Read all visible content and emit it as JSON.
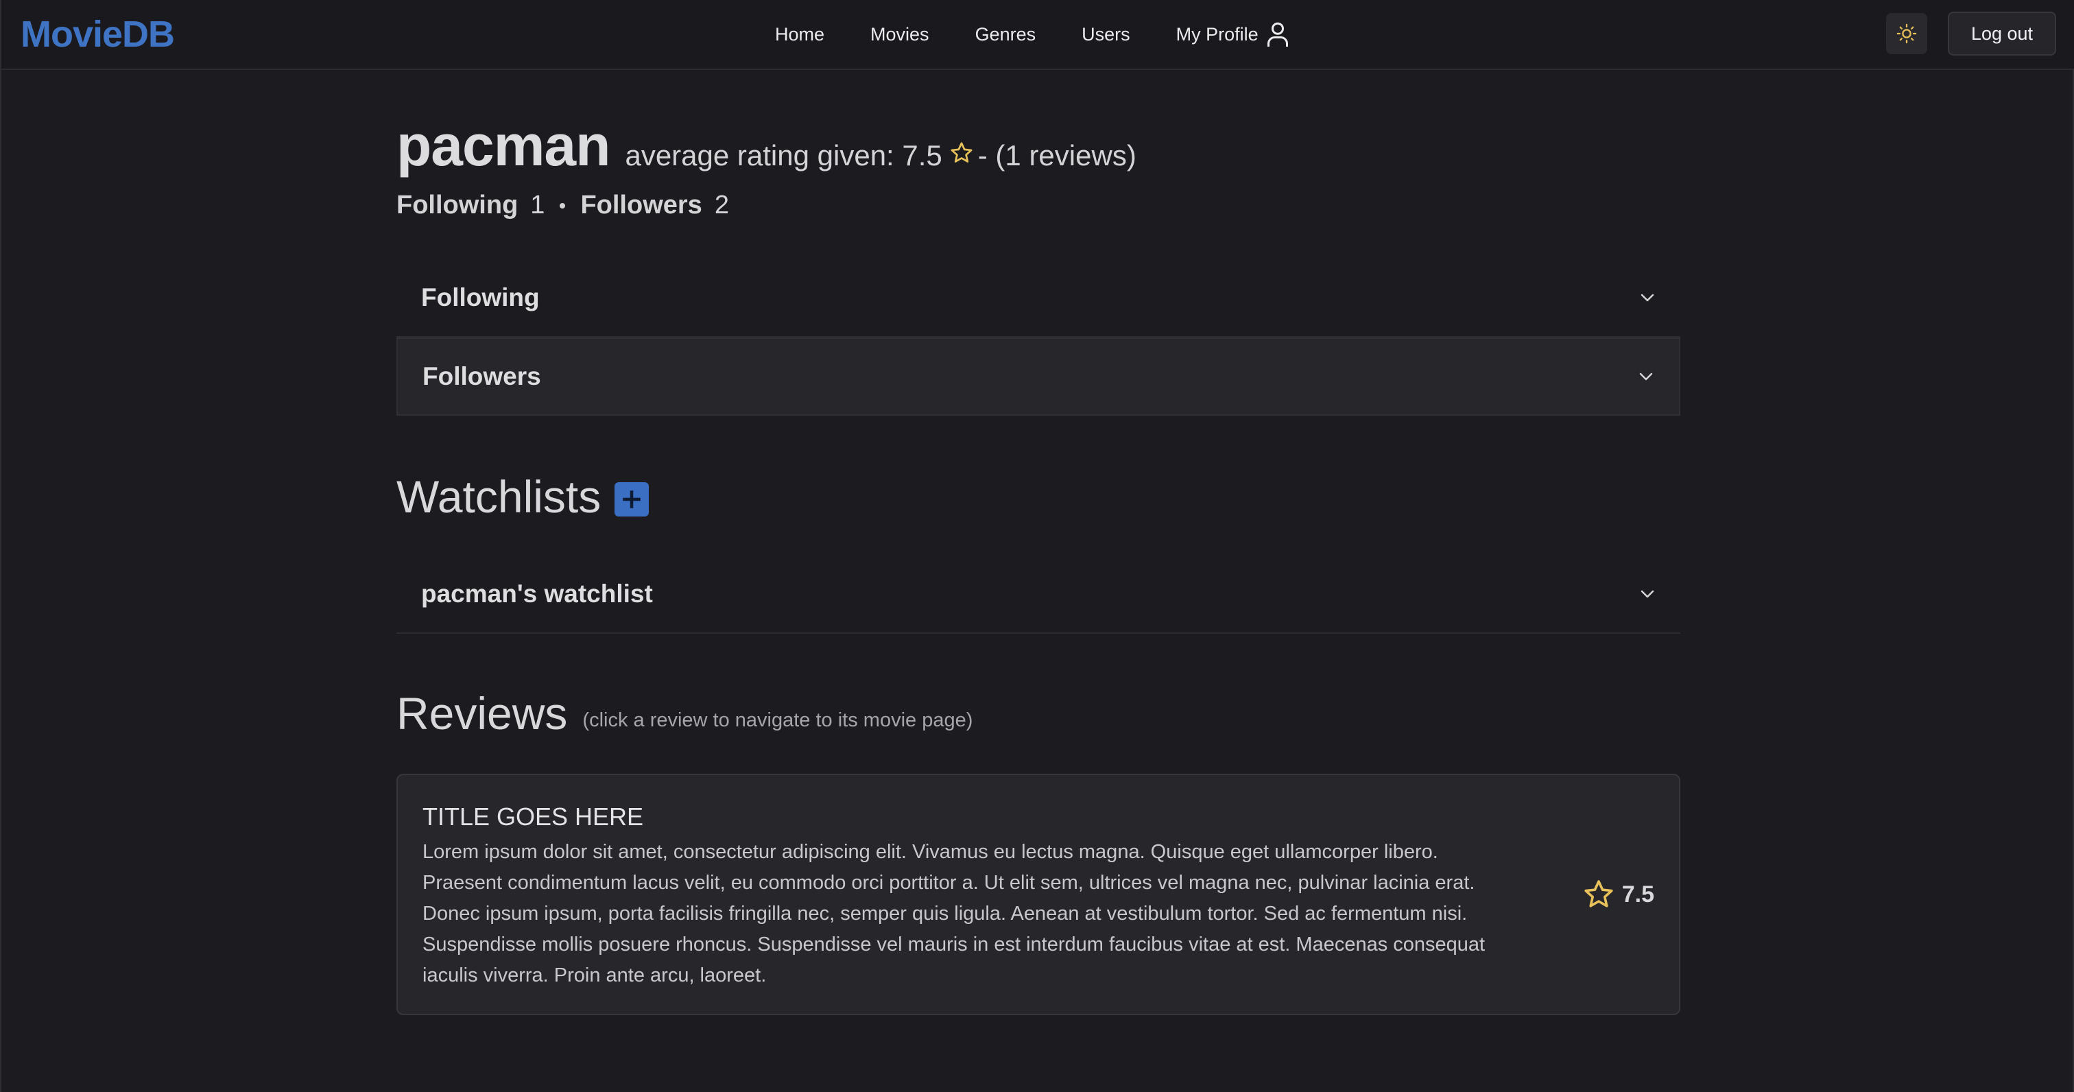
{
  "navbar": {
    "brand": "MovieDB",
    "links": [
      "Home",
      "Movies",
      "Genres",
      "Users",
      "My Profile"
    ],
    "logout_label": "Log out"
  },
  "profile": {
    "username": "pacman",
    "avg_rating_text": "average rating given: 7.5",
    "reviews_count_text": "- (1 reviews)",
    "following_label": "Following",
    "following_count": "1",
    "followers_label": "Followers",
    "followers_count": "2"
  },
  "accordions": {
    "following": "Following",
    "followers": "Followers"
  },
  "watchlists": {
    "title": "Watchlists",
    "items": [
      "pacman's watchlist"
    ]
  },
  "reviews": {
    "title": "Reviews",
    "hint": "(click a review to navigate to its movie page)",
    "items": [
      {
        "title": "TITLE GOES HERE",
        "body": "Lorem ipsum dolor sit amet, consectetur adipiscing elit. Vivamus eu lectus magna. Quisque eget ullamcorper libero. Praesent condimentum lacus velit, eu commodo orci porttitor a. Ut elit sem, ultrices vel magna nec, pulvinar lacinia erat. Donec ipsum ipsum, porta facilisis fringilla nec, semper quis ligula. Aenean at vestibulum tortor. Sed ac fermentum nisi. Suspendisse mollis posuere rhoncus. Suspendisse vel mauris in est interdum faucibus vitae at est. Maecenas consequat iaculis viverra. Proin ante arcu, laoreet.",
        "rating": "7.5"
      }
    ]
  },
  "colors": {
    "brand": "#3f74c4",
    "star": "#e8c15a",
    "accent_button": "#3a6fc4",
    "background": "#1c1c20"
  },
  "icons": {
    "profile": "person-icon",
    "theme": "sun-icon",
    "star": "star-outline-icon",
    "chevron": "chevron-down-icon",
    "add": "plus-icon"
  }
}
